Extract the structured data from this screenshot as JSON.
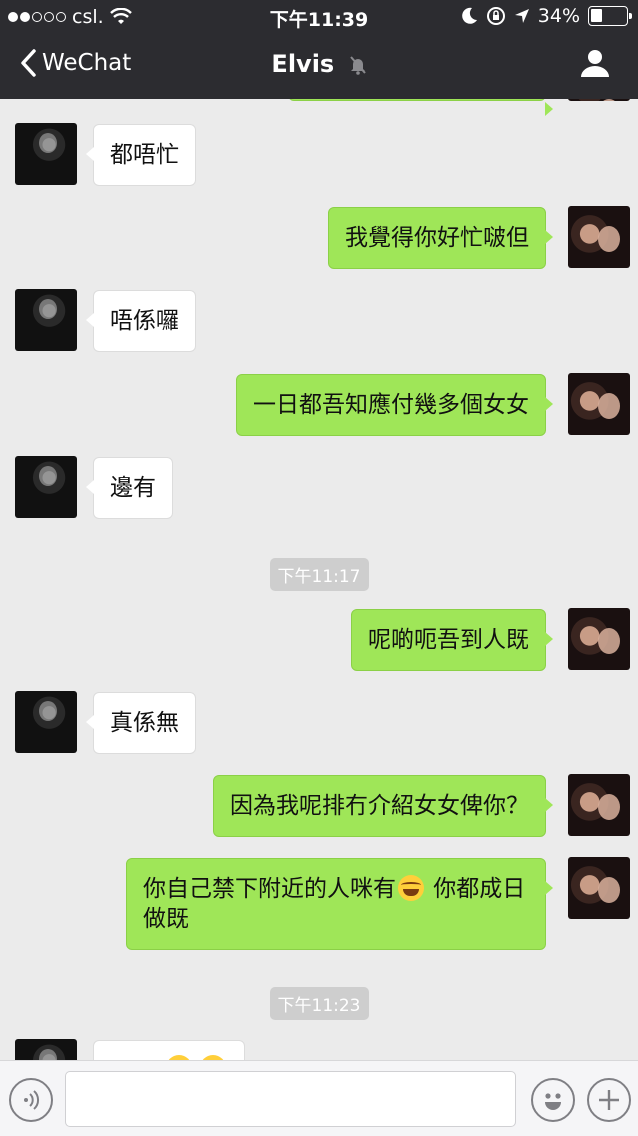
{
  "status_bar": {
    "carrier": "csl.",
    "time": "下午11:39",
    "battery": "34%",
    "battery_level": 0.34
  },
  "nav": {
    "back_label": "WeChat",
    "title": "Elvis"
  },
  "chat": {
    "messages": [
      {
        "side": "in",
        "text": "都唔忙"
      },
      {
        "side": "out",
        "text": "我覺得你好忙啵但"
      },
      {
        "side": "in",
        "text": "唔係囉"
      },
      {
        "side": "out",
        "text": "一日都吾知應付幾多個女女"
      },
      {
        "side": "in",
        "text": "邊有"
      },
      {
        "type": "timestamp",
        "text": "下午11:17"
      },
      {
        "side": "out",
        "text": "呢啲呃吾到人既"
      },
      {
        "side": "in",
        "text": "真係無"
      },
      {
        "side": "out",
        "text": "因為我呢排冇介紹女女俾你？"
      },
      {
        "side": "out",
        "text_before": "你自己禁下附近的人咪有",
        "emoji": "face-with-tears-of-joy",
        "text_after": " 你都成日做既"
      },
      {
        "type": "timestamp",
        "text": "下午11:23"
      }
    ]
  },
  "input_bar": {
    "voice_icon": "voice-icon",
    "emoji_icon": "smiley-icon",
    "plus_icon": "plus-icon"
  },
  "colors": {
    "header_bg": "#2c2c30",
    "chat_bg": "#ebebeb",
    "outgoing_bubble": "#9fe658",
    "incoming_bubble": "#ffffff"
  }
}
